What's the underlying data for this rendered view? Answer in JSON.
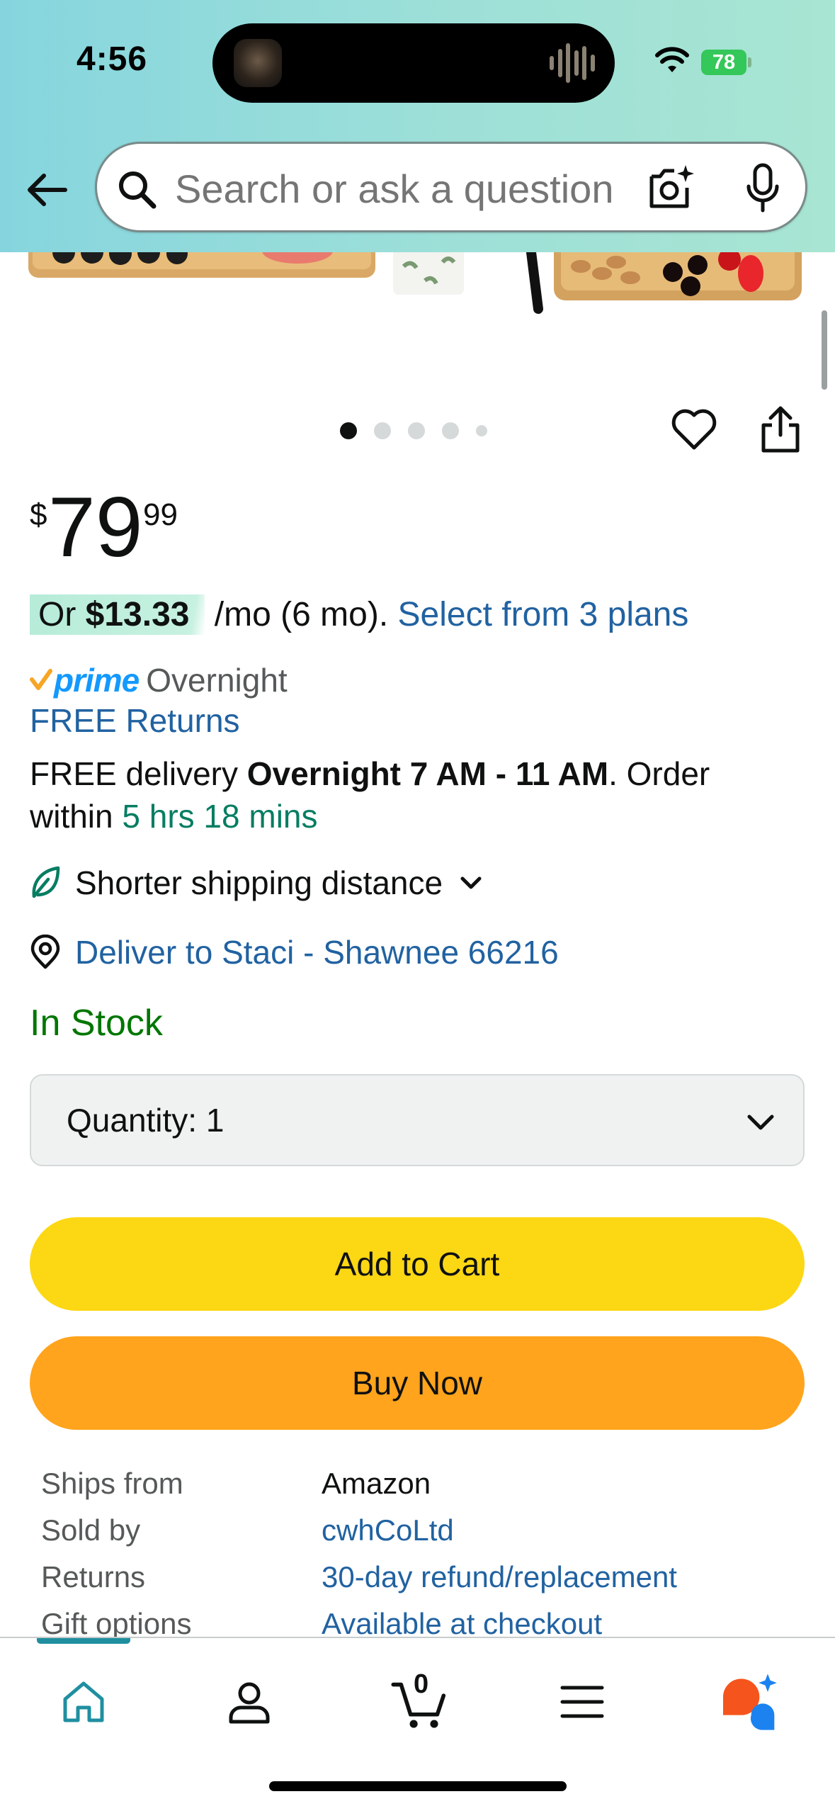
{
  "status_bar": {
    "time": "4:56",
    "battery": "78"
  },
  "search": {
    "placeholder": "Search or ask a question"
  },
  "carousel": {
    "dots": 5,
    "active_index": 0
  },
  "price": {
    "symbol": "$",
    "whole": "79",
    "fraction": "99"
  },
  "installment": {
    "prefix": "Or ",
    "amount": "$13.33",
    "term": " /mo (6 mo). ",
    "plans_link": "Select from 3 plans"
  },
  "prime": {
    "badge": "prime",
    "speed": "Overnight"
  },
  "free_returns": "FREE Returns",
  "delivery": {
    "prefix": "FREE delivery ",
    "window": "Overnight 7 AM - 11 AM",
    "middle": ". Order within ",
    "countdown": "5 hrs 18 mins"
  },
  "eco": {
    "label": "Shorter shipping distance"
  },
  "deliver_to": "Deliver to Staci - Shawnee 66216",
  "stock": "In Stock",
  "quantity": {
    "label": "Quantity:",
    "value": "1"
  },
  "buttons": {
    "add_to_cart": "Add to Cart",
    "buy_now": "Buy Now"
  },
  "details": [
    {
      "key": "Ships from",
      "value": "Amazon",
      "link": false
    },
    {
      "key": "Sold by",
      "value": "cwhCoLtd",
      "link": true
    },
    {
      "key": "Returns",
      "value": "30-day refund/replacement",
      "link": true
    },
    {
      "key": "Gift options",
      "value": "Available at checkout",
      "link": true
    }
  ],
  "tabbar": {
    "active": "home",
    "cart_count": "0",
    "tabs": [
      "home-icon",
      "account-icon",
      "cart-icon",
      "menu-icon",
      "rufus-ai-icon"
    ]
  },
  "colors": {
    "header_gradient_start": "#86d5de",
    "header_gradient_end": "#a8e5d2",
    "link": "#2162a1",
    "countdown": "#067d62",
    "in_stock": "#007600",
    "add_to_cart": "#fcd714",
    "buy_now": "#ffa41c",
    "active_tab": "#1f8fa0",
    "prime_blue": "#1399ff"
  }
}
